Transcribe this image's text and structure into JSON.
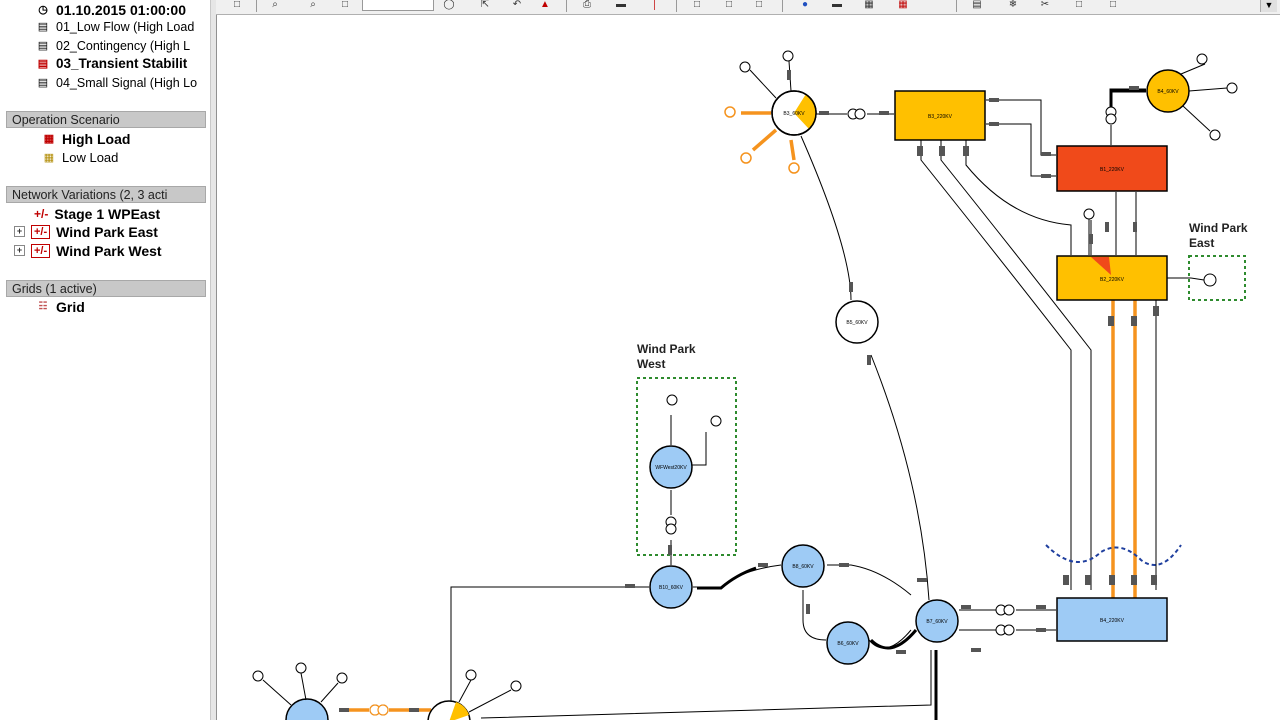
{
  "study_cases": {
    "active_time": "01.10.2015 01:00:00",
    "items": [
      {
        "label": "01_Low Flow (High Load"
      },
      {
        "label": "02_Contingency (High L"
      },
      {
        "label": "03_Transient Stabilit"
      },
      {
        "label": "04_Small Signal (High Lo"
      }
    ]
  },
  "operation_scenario": {
    "header": "Operation Scenario",
    "items": [
      {
        "label": "High Load"
      },
      {
        "label": "Low Load"
      }
    ]
  },
  "network_variations": {
    "header": "Network Variations (2, 3 acti",
    "items": [
      {
        "label": "Stage 1 WPEast",
        "icon": "+/-"
      },
      {
        "label": "Wind Park East",
        "icon": "+/-"
      },
      {
        "label": "Wind Park West",
        "icon": "+/-"
      }
    ]
  },
  "grids": {
    "header": "Grids (1 active)",
    "items": [
      {
        "label": "Grid"
      }
    ]
  },
  "diagram": {
    "group_labels": {
      "wind_park_west": [
        "Wind Park",
        "West"
      ],
      "wind_park_east": [
        "Wind Park",
        "East"
      ]
    },
    "nodes": {
      "b3": "B3_60KV",
      "b5": "B5_60KV",
      "b4": "B4_60KV",
      "wf_west": "WFWest20KV",
      "b10": "B10_60KV",
      "b8": "B8_60KV",
      "b7": "B7_60KV",
      "b6": "B6_60KV",
      "b3_220": "B3_220KV",
      "b1_220": "B1_220KV",
      "b2_220": "B2_220KV",
      "b4_220": "B4_220KV"
    }
  },
  "colors": {
    "orange_line": "#f5931e",
    "bus_yellow": "#ffc000",
    "bus_red": "#f04a1a",
    "bus_blue": "#9ecbf5",
    "dashed_green": "#2e8b2e",
    "dashed_blue": "#1f3f9e"
  }
}
